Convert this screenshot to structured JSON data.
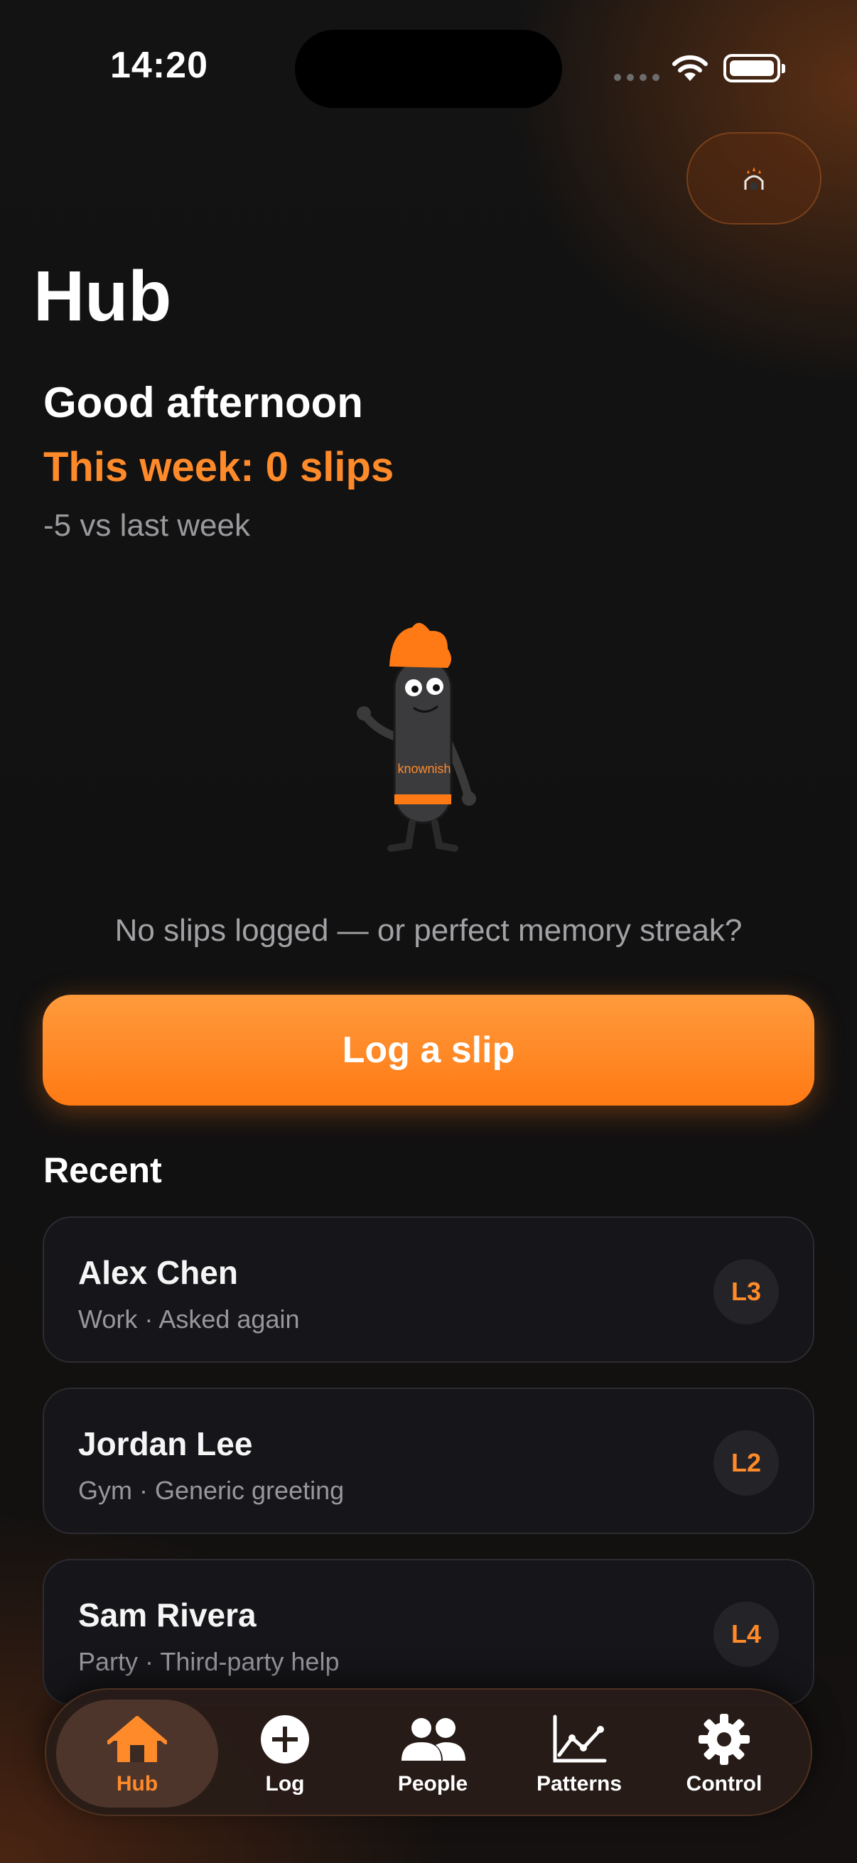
{
  "status_bar": {
    "time": "14:20"
  },
  "header": {
    "title": "Hub"
  },
  "summary": {
    "greeting": "Good afternoon",
    "week_text": "This week: 0 slips",
    "delta_text": "-5 vs last week"
  },
  "mascot": {
    "shirt_text": "knownish"
  },
  "empty_state": {
    "message": "No slips logged — or perfect memory streak?"
  },
  "primary_action": {
    "label": "Log a slip"
  },
  "recent": {
    "title": "Recent",
    "items": [
      {
        "name": "Alex Chen",
        "meta": "Work · Asked again",
        "level": "L3"
      },
      {
        "name": "Jordan Lee",
        "meta": "Gym · Generic greeting",
        "level": "L2"
      },
      {
        "name": "Sam Rivera",
        "meta": "Party · Third-party help",
        "level": "L4"
      }
    ]
  },
  "tabs": [
    {
      "label": "Hub",
      "icon": "home-icon",
      "active": true
    },
    {
      "label": "Log",
      "icon": "plus-circle-icon",
      "active": false
    },
    {
      "label": "People",
      "icon": "people-icon",
      "active": false
    },
    {
      "label": "Patterns",
      "icon": "chart-icon",
      "active": false
    },
    {
      "label": "Control",
      "icon": "gear-icon",
      "active": false
    }
  ],
  "colors": {
    "accent": "#ff8a2a",
    "background": "#121212",
    "card": "#16161a"
  }
}
